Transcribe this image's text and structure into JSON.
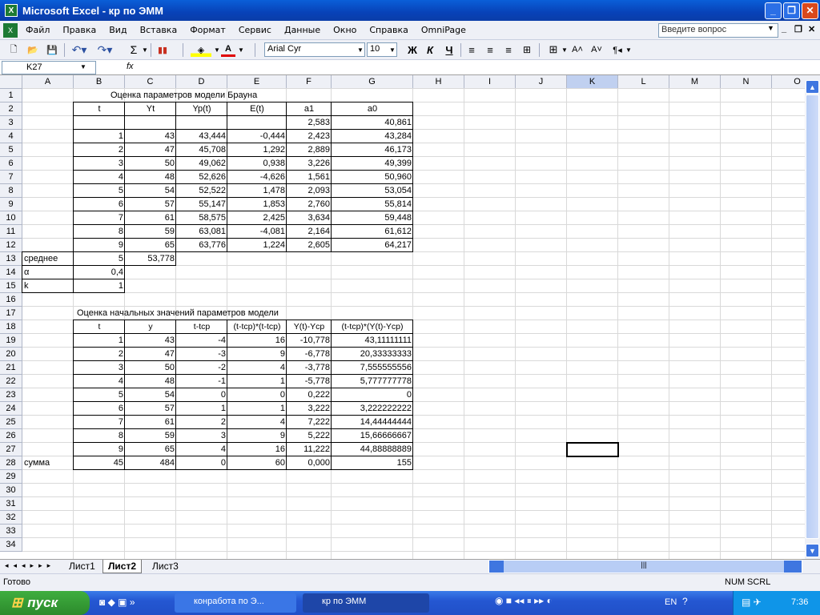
{
  "window": {
    "title": "Microsoft Excel - кр по ЭММ",
    "min": "_",
    "restore": "❐",
    "close": "✕"
  },
  "menu": [
    "Файл",
    "Правка",
    "Вид",
    "Вставка",
    "Формат",
    "Сервис",
    "Данные",
    "Окно",
    "Справка",
    "OmniPage"
  ],
  "ask_placeholder": "Введите вопрос",
  "toolbar": {
    "font": "Arial Cyr",
    "size": "10",
    "bold": "Ж",
    "italic": "К",
    "underline": "Ч",
    "sigma": "Σ"
  },
  "namebox": "K27",
  "fx": "fx",
  "columns": [
    "A",
    "B",
    "C",
    "D",
    "E",
    "F",
    "G",
    "H",
    "I",
    "J",
    "K",
    "L",
    "M",
    "N",
    "O"
  ],
  "rows": [
    "1",
    "2",
    "3",
    "4",
    "5",
    "6",
    "7",
    "8",
    "9",
    "10",
    "11",
    "12",
    "13",
    "14",
    "15",
    "16",
    "17",
    "18",
    "19",
    "20",
    "21",
    "22",
    "23",
    "24",
    "25",
    "26",
    "27",
    "28",
    "29",
    "30",
    "31",
    "32",
    "33",
    "34"
  ],
  "t1": {
    "title": "Оценка параметров модели Брауна",
    "headers": [
      "t",
      "Yt",
      "Yp(t)",
      "E(t)",
      "a1",
      "a0"
    ],
    "row3": [
      "2,583",
      "40,861"
    ],
    "rows": [
      [
        "1",
        "43",
        "43,444",
        "-0,444",
        "2,423",
        "43,284"
      ],
      [
        "2",
        "47",
        "45,708",
        "1,292",
        "2,889",
        "46,173"
      ],
      [
        "3",
        "50",
        "49,062",
        "0,938",
        "3,226",
        "49,399"
      ],
      [
        "4",
        "48",
        "52,626",
        "-4,626",
        "1,561",
        "50,960"
      ],
      [
        "5",
        "54",
        "52,522",
        "1,478",
        "2,093",
        "53,054"
      ],
      [
        "6",
        "57",
        "55,147",
        "1,853",
        "2,760",
        "55,814"
      ],
      [
        "7",
        "61",
        "58,575",
        "2,425",
        "3,634",
        "59,448"
      ],
      [
        "8",
        "59",
        "63,081",
        "-4,081",
        "2,164",
        "61,612"
      ],
      [
        "9",
        "65",
        "63,776",
        "1,224",
        "2,605",
        "64,217"
      ]
    ]
  },
  "stats": [
    [
      "среднее",
      "5",
      "53,778"
    ],
    [
      "α",
      "0,4"
    ],
    [
      "k",
      "1"
    ]
  ],
  "t2": {
    "title": "Оценка начальных значений параметров модели",
    "headers": [
      "t",
      "y",
      "t-tcp",
      "(t-tcp)*(t-tcp)",
      "Y(t)-Ycp",
      "(t-tcp)*(Y(t)-Ycp)"
    ],
    "rows": [
      [
        "1",
        "43",
        "-4",
        "16",
        "-10,778",
        "43,11111111"
      ],
      [
        "2",
        "47",
        "-3",
        "9",
        "-6,778",
        "20,33333333"
      ],
      [
        "3",
        "50",
        "-2",
        "4",
        "-3,778",
        "7,555555556"
      ],
      [
        "4",
        "48",
        "-1",
        "1",
        "-5,778",
        "5,777777778"
      ],
      [
        "5",
        "54",
        "0",
        "0",
        "0,222",
        "0"
      ],
      [
        "6",
        "57",
        "1",
        "1",
        "3,222",
        "3,222222222"
      ],
      [
        "7",
        "61",
        "2",
        "4",
        "7,222",
        "14,44444444"
      ],
      [
        "8",
        "59",
        "3",
        "9",
        "5,222",
        "15,66666667"
      ],
      [
        "9",
        "65",
        "4",
        "16",
        "11,222",
        "44,88888889"
      ]
    ],
    "sum": [
      "сумма",
      "45",
      "484",
      "0",
      "60",
      "0,000",
      "155"
    ]
  },
  "tabs": [
    "Лист1",
    "Лист2",
    "Лист3"
  ],
  "status": {
    "ready": "Готово",
    "num": "NUM",
    "scrl": "SCRL"
  },
  "taskbar": {
    "start": "пуск",
    "items": [
      "конработа по Э...",
      "кр по ЭММ"
    ],
    "lang": "EN",
    "time": "7:36"
  }
}
